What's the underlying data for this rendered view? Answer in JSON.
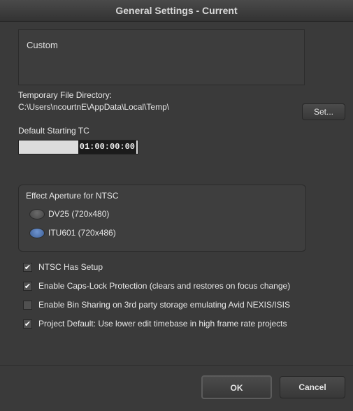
{
  "window": {
    "title": "General Settings - Current"
  },
  "settings_name": "Custom",
  "temp_dir": {
    "label": "Temporary File Directory:",
    "path": "C:\\Users\\ncourtnE\\AppData\\Local\\Temp\\",
    "set_button": "Set..."
  },
  "timecode": {
    "label": "Default Starting TC",
    "value": "01:00:00:00"
  },
  "aperture": {
    "title": "Effect Aperture for NTSC",
    "options": [
      {
        "label": "DV25 (720x480)",
        "selected": false
      },
      {
        "label": "ITU601 (720x486)",
        "selected": true
      }
    ]
  },
  "checkboxes": [
    {
      "label": "NTSC Has Setup",
      "checked": true
    },
    {
      "label": "Enable Caps-Lock Protection (clears and restores on focus change)",
      "checked": true
    },
    {
      "label": "Enable Bin Sharing on 3rd party storage emulating Avid NEXIS/ISIS",
      "checked": false
    },
    {
      "label": "Project Default: Use lower edit timebase in high frame rate projects",
      "checked": true
    }
  ],
  "buttons": {
    "ok": "OK",
    "cancel": "Cancel"
  },
  "icons": {
    "check": "checkmark-icon",
    "check_glyph": "✔"
  }
}
